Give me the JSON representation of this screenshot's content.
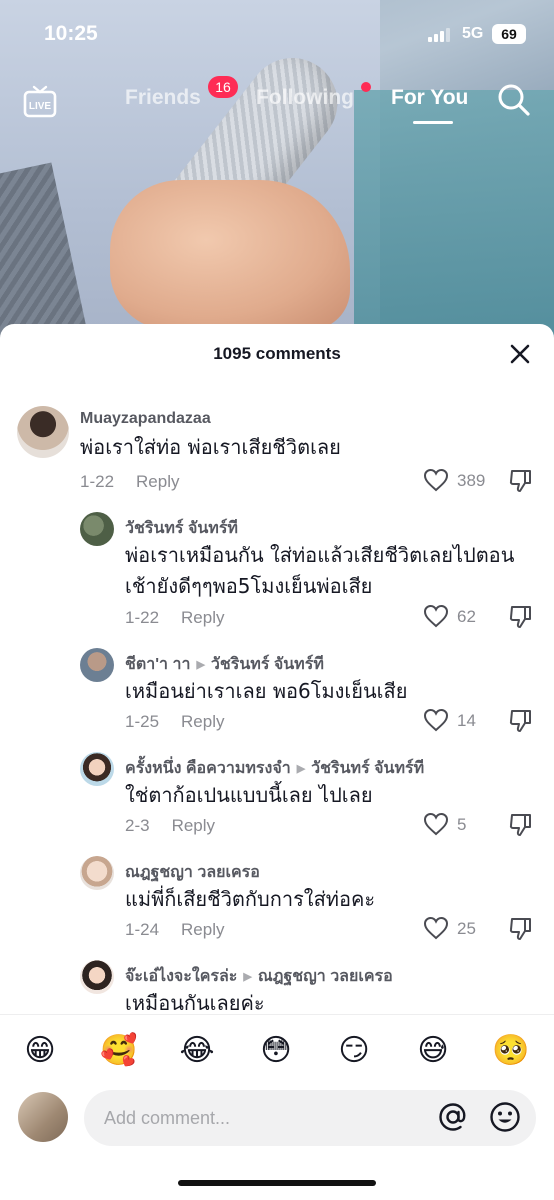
{
  "status_bar": {
    "time": "10:25",
    "network": "5G",
    "battery": "69"
  },
  "top_nav": {
    "live_label": "LIVE",
    "tabs": [
      {
        "label": "Friends",
        "badge": "16"
      },
      {
        "label": "Following"
      },
      {
        "label": "For You",
        "active": true
      }
    ]
  },
  "comments_sheet": {
    "title": "1095 comments",
    "comments": [
      {
        "username": "Muayzapandazaa",
        "reply_to": "",
        "text": "พ่อเราใส่ท่อ พ่อเราเสียชีวิตเลย",
        "date": "1-22",
        "reply_label": "Reply",
        "likes": "389"
      },
      {
        "username": "วัชรินทร์ จันทร์ที",
        "reply_to": "",
        "text": "พ่อเราเหมือนกัน ใส่ท่อแล้วเสียชีวิตเลยไปตอนเช้ายังดีๆๆพอ5โมงเย็นพ่อเสีย",
        "date": "1-22",
        "reply_label": "Reply",
        "likes": "62"
      },
      {
        "username": "ชีตา'า าา",
        "reply_to": "วัชรินทร์ จันทร์ที",
        "text": "เหมือนย่าเราเลย พอ6โมงเย็นเสีย",
        "date": "1-25",
        "reply_label": "Reply",
        "likes": "14"
      },
      {
        "username": "ครั้งหนึ่ง คือความทรงจำ",
        "reply_to": "วัชรินทร์ จันทร์ที",
        "text": "ใช่ตาก้อเปนแบบนี้เลย ไปเลย",
        "date": "2-3",
        "reply_label": "Reply",
        "likes": "5"
      },
      {
        "username": "ณฎฐชญา วลยเครอ",
        "reply_to": "",
        "text": "แม่พี่ก็เสียชีวิตกับการใส่ท่อคะ",
        "date": "1-24",
        "reply_label": "Reply",
        "likes": "25"
      },
      {
        "username": "จ๊ะเอ๋ไงจะใครล่ะ",
        "reply_to": "ณฎฐชญา วลยเครอ",
        "text": "เหมือนกันเลยค่ะ",
        "date": "",
        "reply_label": "",
        "likes": ""
      }
    ]
  },
  "emoji_bar": [
    "😁",
    "🥰",
    "😂",
    "😳",
    "😏",
    "😅",
    "🥺"
  ],
  "comment_input": {
    "placeholder": "Add comment..."
  },
  "colors": {
    "accent": "#fe2c55",
    "text_secondary": "#8a8b91",
    "input_bg": "#f1f1f2"
  }
}
